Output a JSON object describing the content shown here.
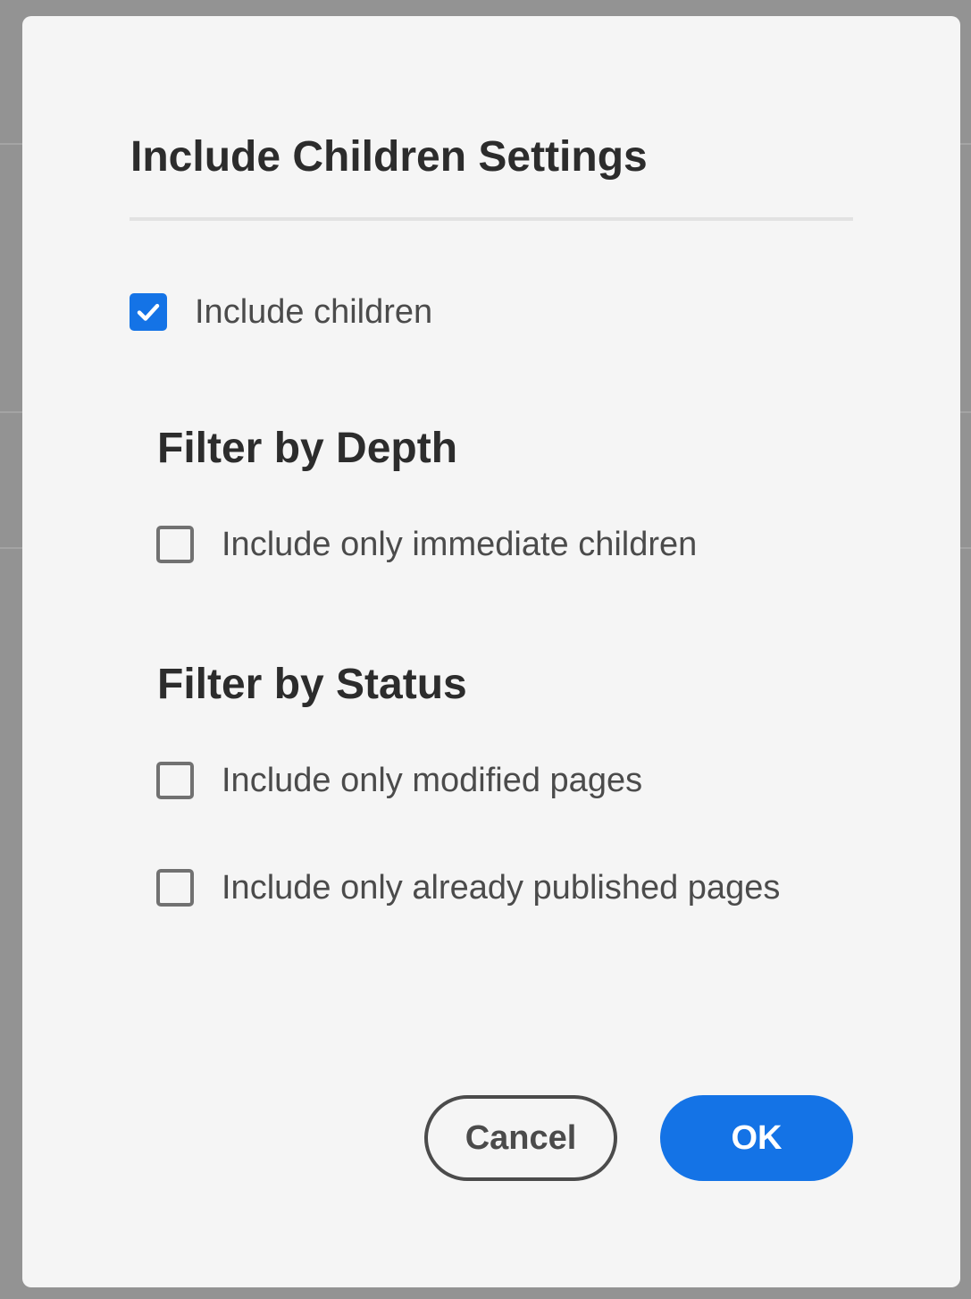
{
  "dialog": {
    "title": "Include Children Settings",
    "include_children": {
      "label": "Include children",
      "checked": true
    },
    "depth_section": {
      "heading": "Filter by Depth",
      "options": [
        {
          "label": "Include only immediate children",
          "checked": false
        }
      ]
    },
    "status_section": {
      "heading": "Filter by Status",
      "options": [
        {
          "label": "Include only modified pages",
          "checked": false
        },
        {
          "label": "Include only already published pages",
          "checked": false
        }
      ]
    },
    "buttons": {
      "cancel_label": "Cancel",
      "ok_label": "OK"
    }
  },
  "colors": {
    "accent": "#1473e6",
    "dialog_background": "#f5f5f5",
    "backdrop": "#939393",
    "heading_text": "#2c2c2c",
    "body_text": "#4b4b4b"
  },
  "icons": {
    "checkmark": "checkmark-icon"
  }
}
